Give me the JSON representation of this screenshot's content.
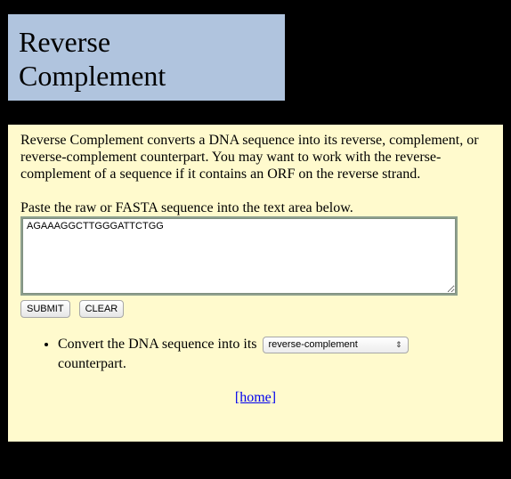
{
  "header": {
    "title": "Reverse Complement"
  },
  "main": {
    "description": "Reverse Complement converts a DNA sequence into its reverse, complement, or reverse-complement counterpart. You may want to work with the reverse-complement of a sequence if it contains an ORF on the reverse strand.",
    "prompt": "Paste the raw or FASTA sequence into the text area below.",
    "sequence_value": "AGAAAGGCTTGGGATTCTGG",
    "submit_label": "SUBMIT",
    "clear_label": "CLEAR",
    "option_prefix": "Convert the DNA sequence into its",
    "option_suffix": "counterpart.",
    "conversion_selected": "reverse-complement",
    "select_arrows_icon": "up-down-arrows-icon",
    "home_link": "[home]"
  },
  "colors": {
    "page_background": "#000000",
    "title_background": "#b0c4de",
    "panel_background": "#fffacd",
    "link": "#0000ee"
  }
}
